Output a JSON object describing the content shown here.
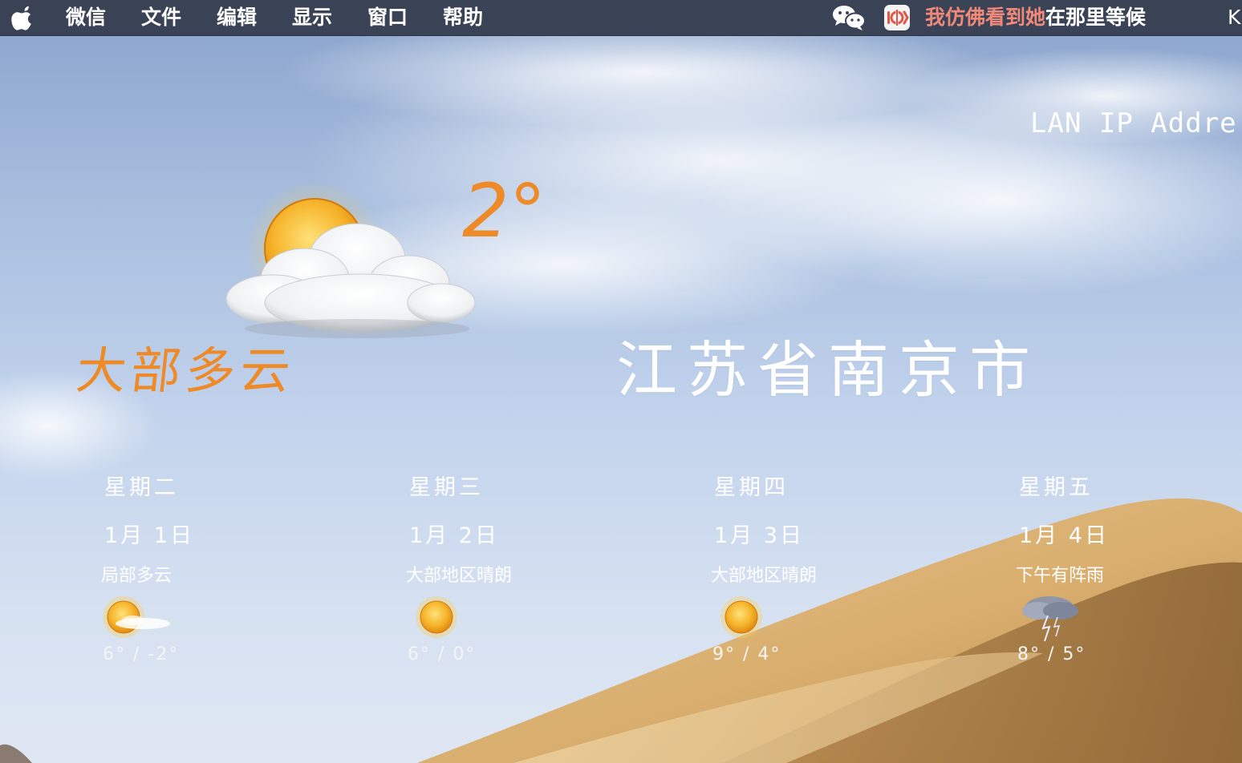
{
  "menubar": {
    "app_name": "微信",
    "items": [
      "文件",
      "编辑",
      "显示",
      "窗口",
      "帮助"
    ],
    "lyric_played": "我仿佛看到她",
    "lyric_rest": "在那里等候",
    "trailing_text": "K"
  },
  "widget": {
    "lan_label": "LAN IP Addre",
    "current": {
      "temperature": "2°",
      "condition": "大部多云",
      "icon": "partly-cloudy-icon"
    },
    "city": "江苏省南京市",
    "forecast": [
      {
        "weekday": "星期二",
        "date": "1月 1日",
        "condition": "局部多云",
        "temps": "6° / -2°",
        "icon": "partly-cloudy-icon"
      },
      {
        "weekday": "星期三",
        "date": "1月 2日",
        "condition": "大部地区晴朗",
        "temps": "6° / 0°",
        "icon": "sun-icon"
      },
      {
        "weekday": "星期四",
        "date": "1月 3日",
        "condition": "大部地区晴朗",
        "temps": "9° / 4°",
        "icon": "sun-icon"
      },
      {
        "weekday": "星期五",
        "date": "1月 4日",
        "condition": "下午有阵雨",
        "temps": "8° / 5°",
        "icon": "thunderstorm-icon"
      }
    ]
  },
  "colors": {
    "accent_orange": "#ee8a27",
    "menubar_bg": "#3a4356",
    "lyric_highlight": "#f1897a"
  }
}
